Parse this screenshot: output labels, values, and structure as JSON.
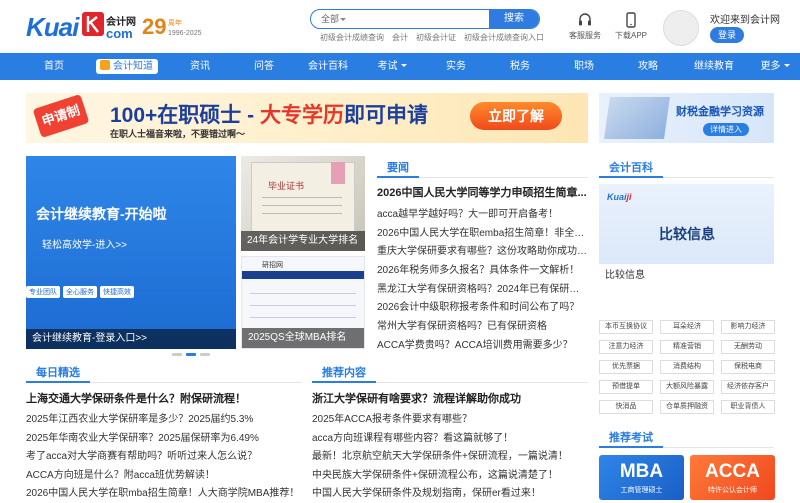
{
  "header": {
    "logo": {
      "brand": "Kuai",
      "cn": "会计网",
      "com": "com"
    },
    "anniversary": {
      "number": "29",
      "suffix": "周年",
      "years": "1996-2025"
    },
    "search": {
      "scope": "全部",
      "placeholder": "",
      "button": "搜索"
    },
    "hotlinks": [
      "初级会计成绩查询",
      "会计",
      "初级会计证",
      "初级会计成绩查询入口"
    ],
    "service": "客服服务",
    "app": "下载APP",
    "welcome": "欢迎来到会计网",
    "login": "登录"
  },
  "nav": {
    "items": [
      "首页",
      "会计知道",
      "资讯",
      "问答",
      "会计百科",
      "考试",
      "实务",
      "税务",
      "职场",
      "攻略",
      "继续教育",
      "更多"
    ]
  },
  "banner": {
    "tag": "申请制",
    "title_a": "100+在职硕士 - ",
    "title_b": "大专学历",
    "title_c": "即可申请",
    "subtitle": "在职人士福音来啦，不要错过啊～",
    "cta": "立即了解"
  },
  "right_banner": {
    "title": "财税金融学习资源",
    "button": "详情进入"
  },
  "slider": {
    "main": {
      "heading": "会计继续教育-开始啦",
      "sub": "轻松高效学-进入>>",
      "badges": [
        "专业团队",
        "全心服务",
        "快捷高效"
      ],
      "caption": "会计继续教育-登录入口>>"
    },
    "second": {
      "paper_title": "毕业证书",
      "caption": "24年会计学专业大学排名"
    },
    "third": {
      "site": "研招网",
      "caption": "2025QS全球MBA排名"
    }
  },
  "yaowen": {
    "title": "要闻",
    "headline": "2026中国人民大学同等学力申硕招生简章...",
    "items": [
      "acca越早学越好吗？大一即可开启备考！",
      "2026中国人民大学在职emba招生简章！非全em...",
      "重庆大学保研要求有哪些？这份攻略助你成功突围",
      "2026年税务师多久报名？具体条件一文解析！",
      "黑龙江大学有保研资格吗？2024年已有保研资格",
      "2026会计中级职称报考条件和时间公布了吗？",
      "常州大学有保研资格吗？已有保研资格",
      "ACCA学费贵吗？ACCA培训费用需要多少？"
    ]
  },
  "daily": {
    "title": "每日精选",
    "headline": "上海交通大学保研条件是什么？附保研流程！",
    "items": [
      "2025年江西农业大学保研率是多少？2025届约5.3%",
      "2025年华南农业大学保研率？2025届保研率为6.49%",
      "考了acca对大学商赛有帮助吗？听听过来人怎么说？",
      "ACCA方向班是什么？附acca班优势解读！",
      "2026中国人民大学在职mba招生简章！人大商学院MBA推荐！"
    ]
  },
  "recommend": {
    "title": "推荐内容",
    "headline": "浙江大学保研有啥要求？流程详解助你成功",
    "items": [
      "2025年ACCA报考条件要求有哪些？",
      "acca方向班课程有哪些内容？看这篇就够了！",
      "最新！北京航空航天大学保研条件+保研流程，一篇说清！",
      "中央民族大学保研条件+保研流程公布，这篇说清楚了！",
      "中国人民大学保研条件及规划指南，保研er看过来！"
    ]
  },
  "baike": {
    "title": "会计百科",
    "logo_a": "Kuai",
    "logo_b": "ji",
    "card_title": "比较信息",
    "card_label": "比较信息",
    "tags": [
      "本币互换协议",
      "耳朵经济",
      "影响力经济",
      "注意力经济",
      "精准营销",
      "无酬劳动",
      "优先票据",
      "消费结构",
      "保税电商",
      "预借提单",
      "大额风险暴露",
      "经济依存客户",
      "快消品",
      "仓单质押融资",
      "职业背债人"
    ]
  },
  "exams": {
    "title": "推荐考试",
    "cards": [
      {
        "name": "MBA",
        "sub": "工商管理硕士"
      },
      {
        "name": "ACCA",
        "sub": "特许公认会计师"
      }
    ]
  }
}
